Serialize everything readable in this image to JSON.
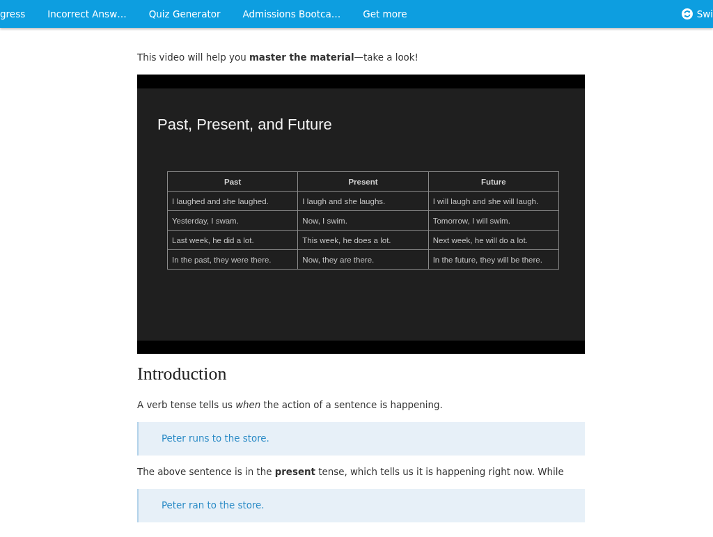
{
  "nav": {
    "items": [
      {
        "label": "gress"
      },
      {
        "label": "Incorrect Answ…"
      },
      {
        "label": "Quiz Generator"
      },
      {
        "label": "Admissions Bootca…"
      },
      {
        "label": "Get more"
      }
    ],
    "switch": {
      "label": "Swi"
    }
  },
  "intro": "This video will help you **master the material**—take a look!",
  "video": {
    "title": "Past, Present, and Future",
    "table": {
      "columns": [
        "Past",
        "Present",
        "Future"
      ],
      "rows": [
        [
          "I laughed and she laughed.",
          "I laugh and she laughs.",
          "I will laugh and she will laugh."
        ],
        [
          "Yesterday, I swam.",
          "Now, I swim.",
          "Tomorrow, I will swim."
        ],
        [
          "Last week, he did a lot.",
          "This week, he does a lot.",
          "Next week, he will do a lot."
        ],
        [
          "In the past, they were there.",
          "Now, they are there.",
          "In the future, they will be there."
        ]
      ]
    }
  },
  "section": {
    "heading": "Introduction",
    "blocks": [
      {
        "kind": "paragraph",
        "text": "A verb tense tells us *when* the action of a sentence is happening."
      },
      {
        "kind": "example",
        "text": "Peter runs to the store."
      },
      {
        "kind": "paragraph",
        "text": "The above sentence is in the **present** tense, which tells us it is happening right now. While"
      },
      {
        "kind": "example",
        "text": "Peter ran to the store."
      }
    ]
  }
}
